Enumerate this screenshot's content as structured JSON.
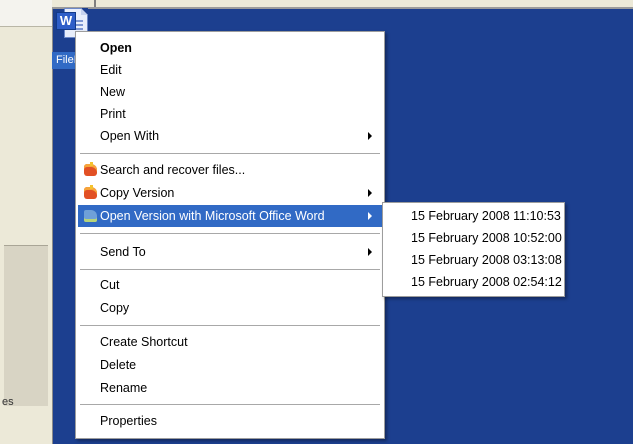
{
  "desktop": {
    "icon_label": "FileKeeper",
    "background_snippet": "es"
  },
  "context_menu": {
    "items": [
      {
        "label": "Open"
      },
      {
        "label": "Edit"
      },
      {
        "label": "New"
      },
      {
        "label": "Print"
      },
      {
        "label": "Open With"
      },
      {
        "label": "Search and recover files..."
      },
      {
        "label": "Copy Version"
      },
      {
        "label": "Open Version with Microsoft Office Word"
      },
      {
        "label": "Send To"
      },
      {
        "label": "Cut"
      },
      {
        "label": "Copy"
      },
      {
        "label": "Create Shortcut"
      },
      {
        "label": "Delete"
      },
      {
        "label": "Rename"
      },
      {
        "label": "Properties"
      }
    ]
  },
  "submenu": {
    "items": [
      {
        "label": "15 February 2008 11:10:53"
      },
      {
        "label": "15 February 2008 10:52:00"
      },
      {
        "label": "15 February 2008 03:13:08"
      },
      {
        "label": "15 February 2008 02:54:12"
      }
    ]
  },
  "colors": {
    "desktop_background": "#1c3f8f",
    "highlight": "#316ac5",
    "menu_background": "#ffffff"
  },
  "icons": {
    "file": "word-document-icon",
    "search_recover": "filekeeper-red-icon",
    "copy_version": "filekeeper-red-icon",
    "open_version": "filekeeper-blue-icon"
  }
}
